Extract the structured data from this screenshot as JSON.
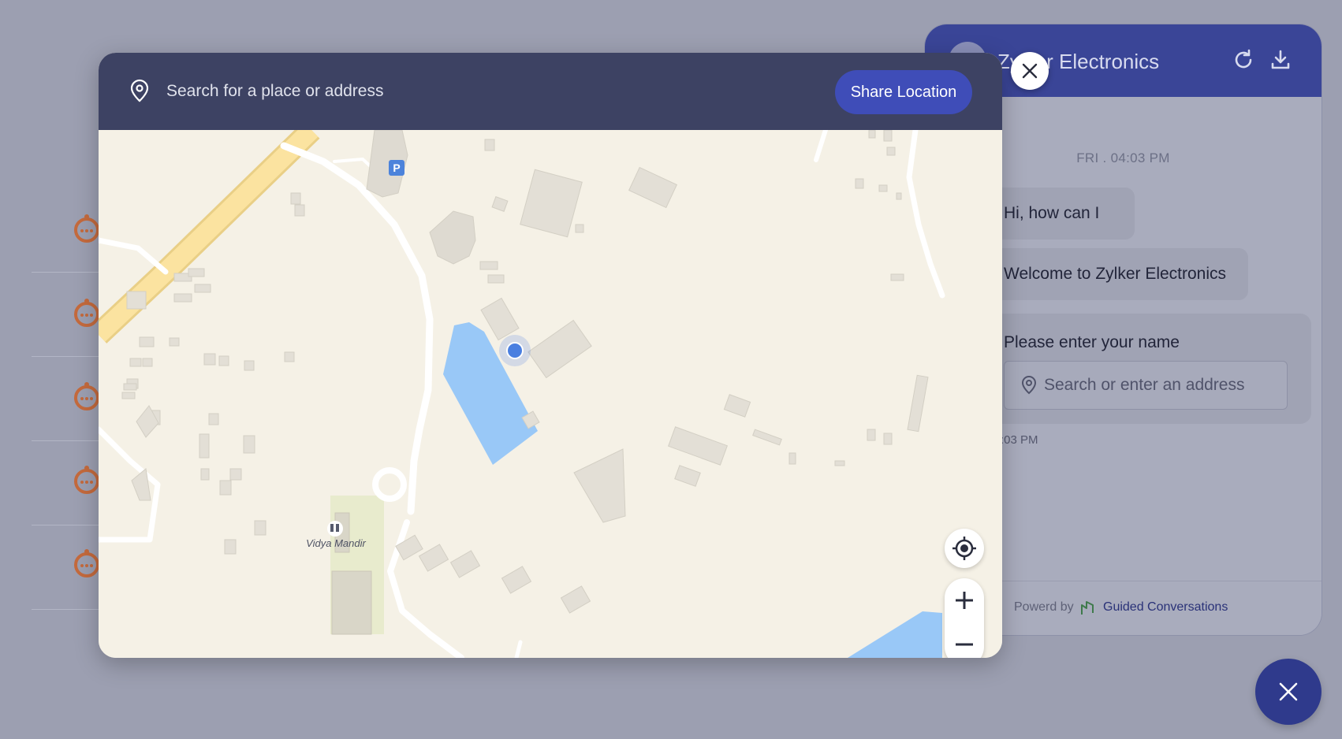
{
  "chat": {
    "title": "Zylker Electronics",
    "timestamp": "FRI . 04:03 PM",
    "messages": [
      "Hi, how can I help?",
      "Welcome to Zylker Electronics"
    ],
    "prompt": "Please enter your name",
    "address_placeholder": "Search or enter an address",
    "message_time": ":03 PM",
    "footer_text": "Powerd by",
    "footer_brand": "Guided Conversations",
    "icons": [
      "refresh-icon",
      "download-icon",
      "close-icon"
    ]
  },
  "map_modal": {
    "search_placeholder": "Search for a place or address",
    "share_button": "Share Location",
    "map_labels": {
      "school": "Vidya Mandir",
      "parking": "P"
    },
    "controls": [
      "my-location-icon",
      "zoom-in-icon",
      "zoom-out-icon"
    ]
  },
  "colors": {
    "overlay": "#9c9fb1",
    "header": "#3d4263",
    "accent": "#3f4db8",
    "chat_header": "#3a4597",
    "water": "#99c8f7",
    "road_major": "#fbe3a0",
    "location_dot": "#4a7fe0"
  }
}
